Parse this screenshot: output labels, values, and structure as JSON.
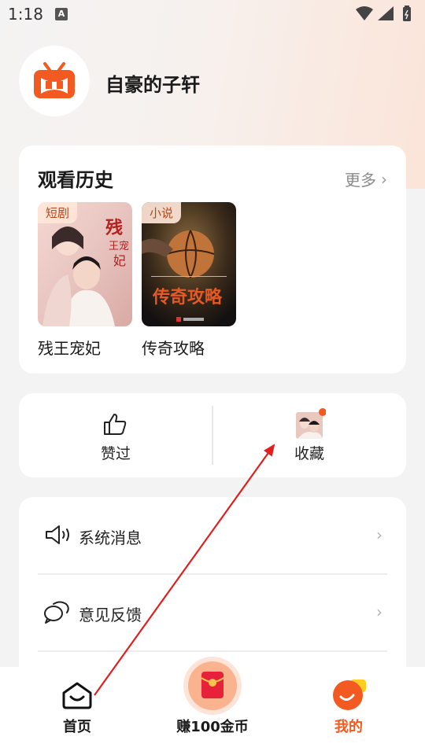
{
  "status_bar": {
    "time": "1:18",
    "notification_badge": "A",
    "icons": [
      "wifi-icon",
      "cell-signal-icon",
      "battery-icon"
    ]
  },
  "profile": {
    "username": "自豪的子轩",
    "avatar_icon": "tv-logo-icon"
  },
  "history": {
    "title": "观看历史",
    "more_label": "更多",
    "items": [
      {
        "tag": "短剧",
        "title": "残王宠妃"
      },
      {
        "tag": "小说",
        "title": "传奇攻略"
      }
    ]
  },
  "actions": {
    "liked_label": "赞过",
    "favorites_label": "收藏"
  },
  "menu": {
    "items": [
      {
        "label": "系统消息",
        "icon": "speaker-icon"
      },
      {
        "label": "意见反馈",
        "icon": "chat-bubbles-icon"
      }
    ]
  },
  "tabbar": {
    "tabs": [
      {
        "label": "首页",
        "icon": "home-icon"
      },
      {
        "label": "赚100金币",
        "icon": "red-envelope-icon"
      },
      {
        "label": "我的",
        "icon": "profile-icon"
      }
    ]
  },
  "colors": {
    "accent": "#f25a21",
    "annotation_arrow": "#e01f1f"
  }
}
